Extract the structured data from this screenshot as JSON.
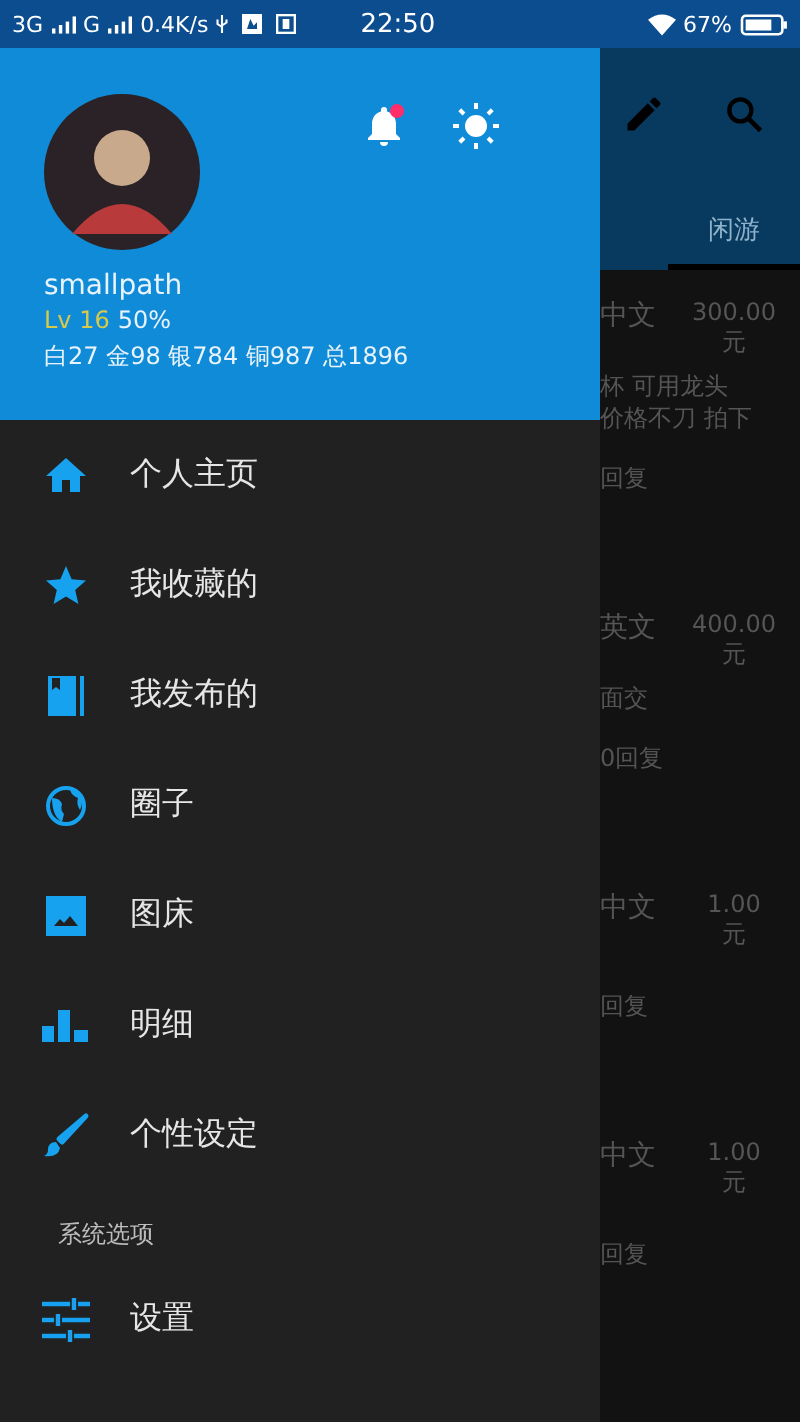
{
  "status_bar": {
    "left": [
      "3G",
      "G",
      "0.4K/s"
    ],
    "time": "22:50",
    "battery": "67%"
  },
  "background": {
    "tabs": [
      {
        "label": "闲游",
        "selected": true
      }
    ],
    "posts": [
      {
        "tag": "中文",
        "price": "300.00",
        "unit": "元",
        "lines": [
          "杯 可用龙头",
          "价格不刀 拍下"
        ],
        "replies": "回复"
      },
      {
        "tag": "英文",
        "price": "400.00",
        "unit": "元",
        "lines": [
          "面交"
        ],
        "replies": "0回复"
      },
      {
        "tag": "中文",
        "price": "1.00",
        "unit": "元",
        "replies": "回复"
      },
      {
        "tag": "中文",
        "price": "1.00",
        "unit": "元",
        "replies": "回复"
      }
    ]
  },
  "drawer": {
    "has_notification": true,
    "user": {
      "name": "smallpath",
      "level": "Lv 16",
      "progress": "50%",
      "stats": "白27 金98 银784 铜987 总1896"
    },
    "items": [
      {
        "label": "个人主页"
      },
      {
        "label": "我收藏的"
      },
      {
        "label": "我发布的"
      },
      {
        "label": "圈子"
      },
      {
        "label": "图床"
      },
      {
        "label": "明细"
      },
      {
        "label": "个性设定"
      }
    ],
    "section": "系统选项",
    "settings": {
      "label": "设置"
    }
  }
}
